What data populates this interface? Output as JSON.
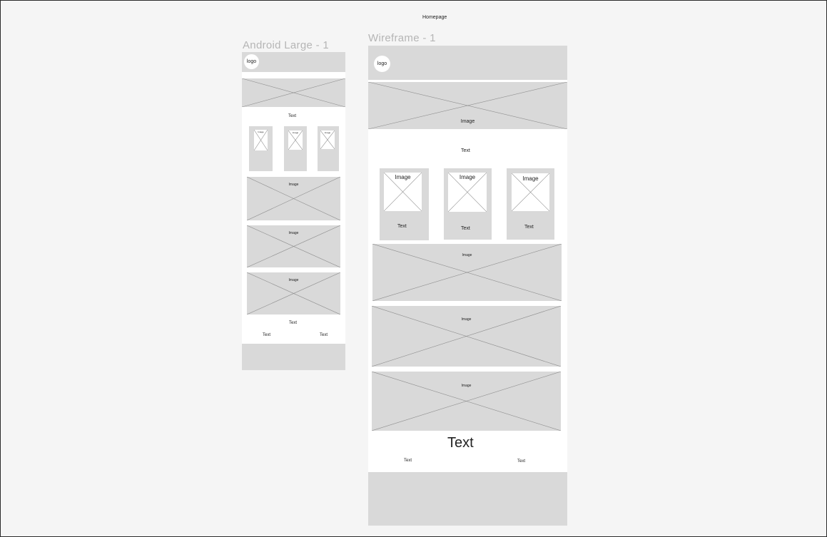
{
  "page_title": "Homepage",
  "frames": {
    "android": {
      "label": "Android Large - 1",
      "logo": "logo",
      "section_text": "Text",
      "card_image": "Image",
      "image_label": "Image",
      "footer_title": "Text",
      "footer_left": "Text",
      "footer_right": "Text"
    },
    "wireframe": {
      "label": "Wireframe - 1",
      "logo": "logo",
      "hero_image": "Image",
      "section_text": "Text",
      "card_image": "Image",
      "card_text": "Text",
      "image_label": "Image",
      "footer_title": "Text",
      "footer_left": "Text",
      "footer_right": "Text"
    }
  }
}
